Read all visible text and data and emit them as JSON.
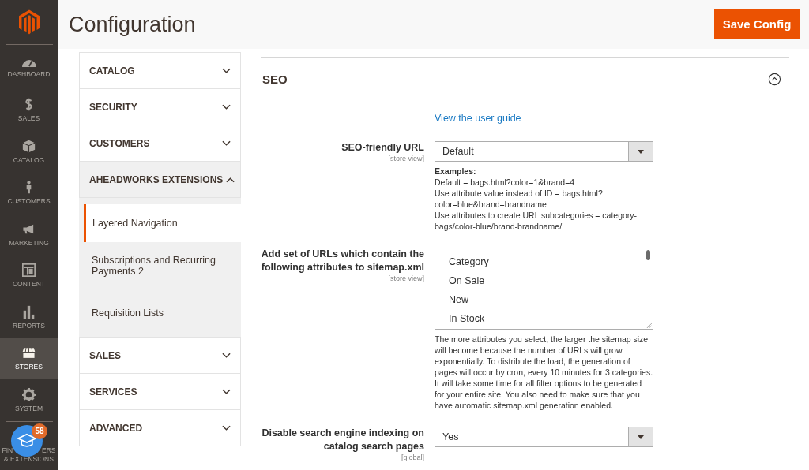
{
  "sidebar": {
    "items": [
      {
        "label": "DASHBOARD",
        "selected": false
      },
      {
        "label": "SALES",
        "selected": false
      },
      {
        "label": "CATALOG",
        "selected": false
      },
      {
        "label": "CUSTOMERS",
        "selected": false
      },
      {
        "label": "MARKETING",
        "selected": false
      },
      {
        "label": "CONTENT",
        "selected": false
      },
      {
        "label": "REPORTS",
        "selected": false
      },
      {
        "label": "STORES",
        "selected": true
      },
      {
        "label": "SYSTEM",
        "selected": false
      }
    ],
    "partners": {
      "label_start": "FIN",
      "label_end": "ERS",
      "label_line2": "& EXTENSIONS",
      "badge": "58"
    }
  },
  "header": {
    "title": "Configuration",
    "save_button": "Save Config"
  },
  "config_nav": [
    {
      "label": "CATALOG",
      "expanded": false
    },
    {
      "label": "SECURITY",
      "expanded": false
    },
    {
      "label": "CUSTOMERS",
      "expanded": false
    },
    {
      "label": "AHEADWORKS EXTENSIONS",
      "expanded": true,
      "children": [
        {
          "label": "Layered Navigation",
          "selected": true
        },
        {
          "label": "Subscriptions and Recurring Payments 2",
          "selected": false
        },
        {
          "label": "Requisition Lists",
          "selected": false
        }
      ]
    },
    {
      "label": "SALES",
      "expanded": false
    },
    {
      "label": "SERVICES",
      "expanded": false
    },
    {
      "label": "ADVANCED",
      "expanded": false
    }
  ],
  "section": {
    "title": "SEO",
    "expanded": true,
    "link": "View the user guide",
    "fields": [
      {
        "kind": "select",
        "label": "SEO-friendly URL",
        "scope": "[store view]",
        "value": "Default",
        "note_title": "Examples:",
        "note_lines": [
          "Default = bags.html?color=1&brand=4",
          "Use attribute value instead of ID = bags.html? color=blue&brand=brandname",
          "Use attributes to create URL subcategories = category-bags/color-blue/brand-brandname/"
        ]
      },
      {
        "kind": "multiselect",
        "label": "Add set of URLs which contain the following attributes to sitemap.xml",
        "scope": "[store view]",
        "options": [
          {
            "label": "Category",
            "selected": false
          },
          {
            "label": "On Sale",
            "selected": false
          },
          {
            "label": "New",
            "selected": false
          },
          {
            "label": "In Stock",
            "selected": false
          }
        ],
        "note_lines": [
          "The more attributes you select, the larger the sitemap size will become because the number of URLs will grow exponentially. To distribute the load, the generation of pages will occur by cron, every 10 minutes for 3 categories. It will take some time for all filter options to be generated for your entire site. You also need to make sure that you have automatic sitemap.xml generation enabled."
        ]
      },
      {
        "kind": "select",
        "label": "Disable search engine indexing on catalog search pages",
        "scope": "[global]",
        "value": "Yes"
      }
    ]
  }
}
